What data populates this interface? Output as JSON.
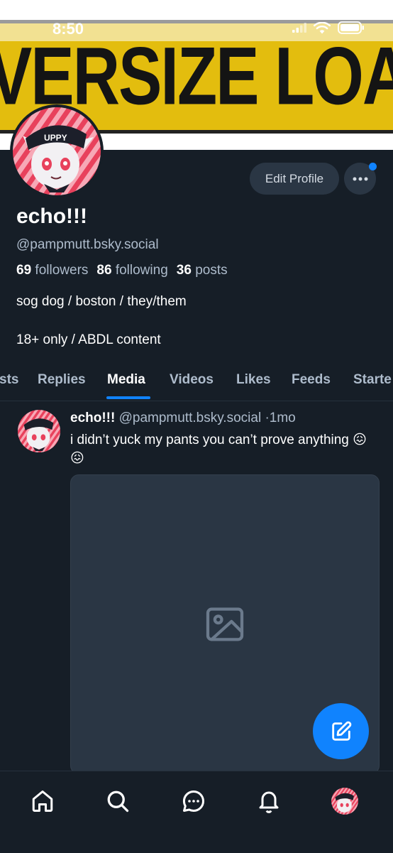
{
  "status_bar": {
    "time": "8:50"
  },
  "banner": {
    "text": "OVERSIZE LOAD"
  },
  "profile": {
    "name": "echo!!!",
    "handle": "@pampmutt.bsky.social",
    "followers_count": "69",
    "followers_label": "followers",
    "following_count": "86",
    "following_label": "following",
    "posts_count": "36",
    "posts_label": "posts",
    "bio_line1": "sog dog / boston / they/them",
    "bio_line2": "18+ only / ABDL content",
    "edit_profile_label": "Edit Profile",
    "avatar_cap_text": "UPPY"
  },
  "tabs": [
    {
      "label": "Posts",
      "visible_text": "sts",
      "active": false
    },
    {
      "label": "Replies",
      "active": false
    },
    {
      "label": "Media",
      "active": true
    },
    {
      "label": "Videos",
      "active": false
    },
    {
      "label": "Likes",
      "active": false
    },
    {
      "label": "Feeds",
      "active": false
    },
    {
      "label": "Starter Packs",
      "visible_text": "Starte",
      "active": false
    }
  ],
  "post": {
    "author_name": "echo!!!",
    "author_handle": "@pampmutt.bsky.social",
    "separator": "·",
    "time_ago": "1mo",
    "text": "i didn’t yuck my pants you can’t prove anything 😖😖"
  },
  "bottom_nav": [
    {
      "icon": "home-icon"
    },
    {
      "icon": "search-icon"
    },
    {
      "icon": "chat-icon"
    },
    {
      "icon": "bell-icon"
    },
    {
      "icon": "profile-avatar"
    }
  ],
  "colors": {
    "background": "#161e27",
    "accent": "#1083fe",
    "secondary_text": "#aebccc",
    "button_bg": "#2a3644"
  }
}
